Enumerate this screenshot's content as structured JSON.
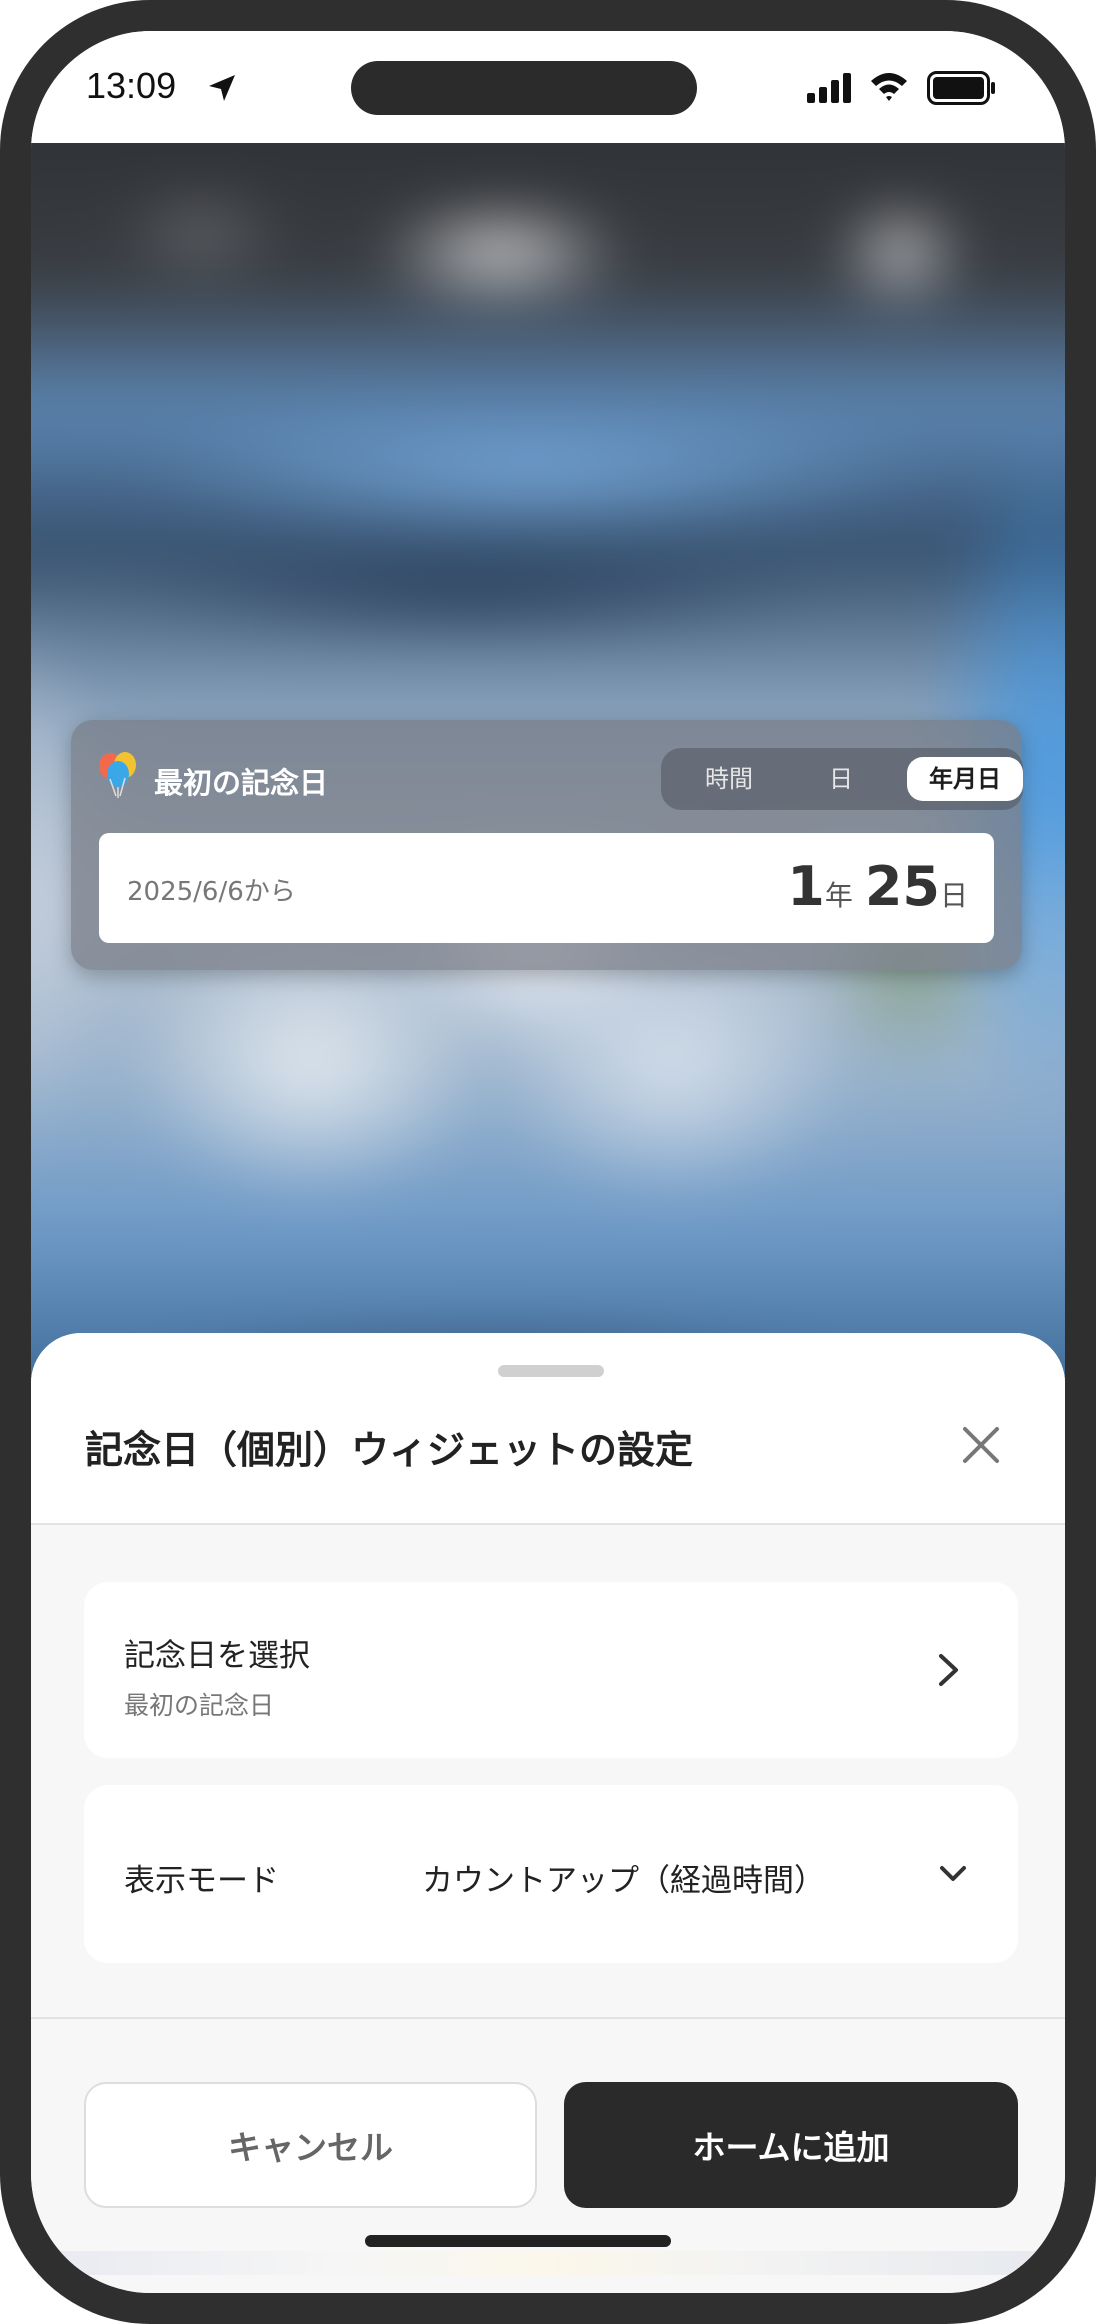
{
  "status_bar": {
    "time": "13:09"
  },
  "widget": {
    "title": "最初の記念日",
    "segments": [
      "時間",
      "日",
      "年月日"
    ],
    "selected_segment": "年月日",
    "since_text": "2025/6/6から",
    "years": "1",
    "years_unit": "年",
    "days": "25",
    "days_unit": "日"
  },
  "sheet": {
    "title": "記念日（個別）ウィジェットの設定",
    "select_row": {
      "label": "記念日を選択",
      "value": "最初の記念日"
    },
    "mode_row": {
      "label": "表示モード",
      "value": "カウントアップ（経過時間）"
    },
    "cancel_label": "キャンセル",
    "add_label": "ホームに追加"
  },
  "colors": {
    "primary_button": "#2a2a2a",
    "sheet_background": "#f7f7f7",
    "card_background": "#ffffff"
  },
  "icons": {
    "location": "location-arrow-icon",
    "signal": "cellular-signal-icon",
    "wifi": "wifi-icon",
    "battery": "battery-icon",
    "widget": "balloon-icon",
    "close": "close-icon",
    "chevron_right": "chevron-right-icon",
    "chevron_down": "chevron-down-icon"
  }
}
